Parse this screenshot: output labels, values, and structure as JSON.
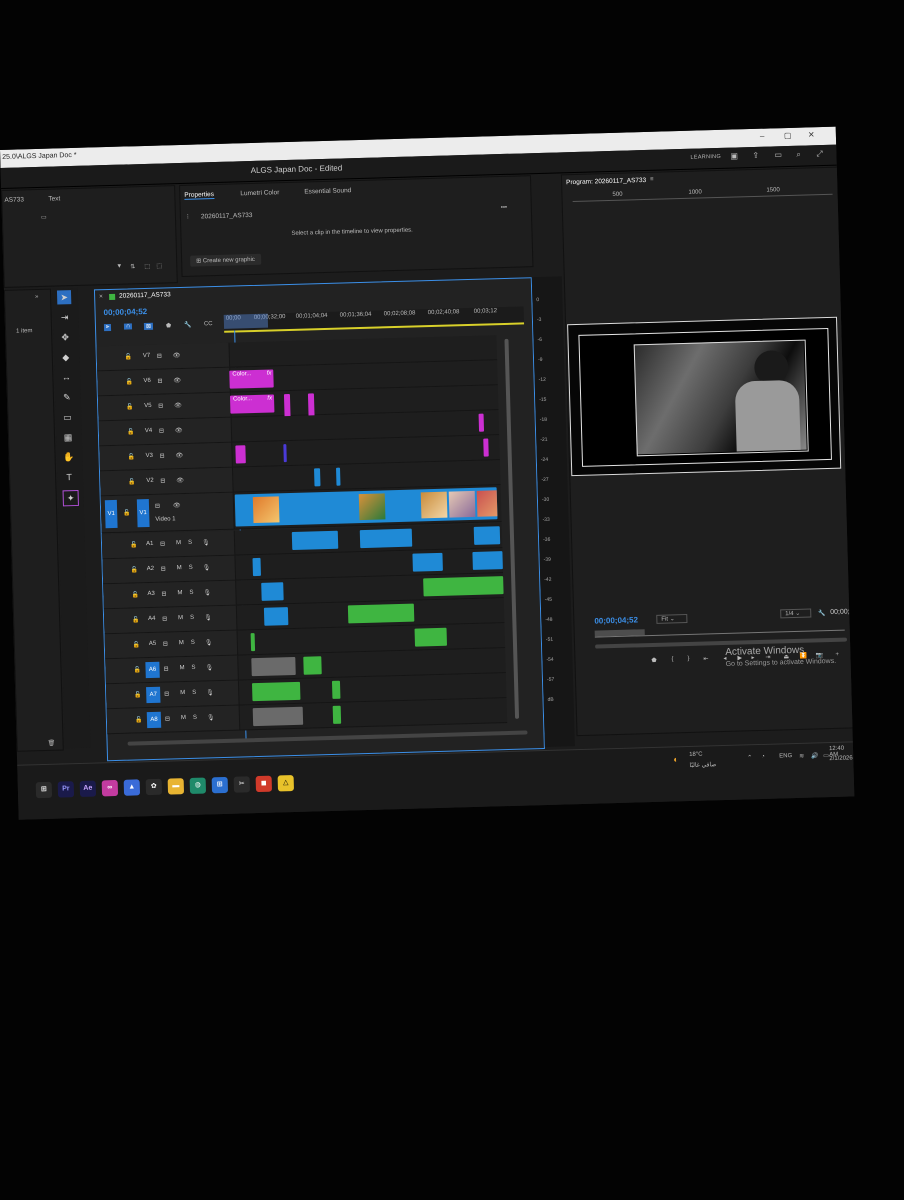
{
  "window": {
    "path_title": "25.0\\ALGS Japan Doc *",
    "app_title": "ALGS Japan Doc - Edited",
    "learning_label": "LEARNING"
  },
  "left_panel": {
    "tabs": [
      "AS733",
      "Text"
    ],
    "item_count": "1 item"
  },
  "properties_panel": {
    "tabs": [
      "Properties",
      "Lumetri Color",
      "Essential Sound"
    ],
    "sequence_name": "20260117_AS733",
    "hint": "Select a clip in the timeline to view properties.",
    "create_graphic": "Create new graphic"
  },
  "timeline": {
    "sequence_name": "20260117_AS733",
    "timecode": "00;00;04;52",
    "ruler_labels": [
      "00;00",
      "00;00;32;00",
      "00;01;04;04",
      "00;01;36;04",
      "00;02;08;08",
      "00;02;40;08",
      "00;03;12"
    ],
    "video_tracks": [
      {
        "label": "V7"
      },
      {
        "label": "V6"
      },
      {
        "label": "V5"
      },
      {
        "label": "V4"
      },
      {
        "label": "V3"
      },
      {
        "label": "V2"
      },
      {
        "label": "V1",
        "name": "Video 1",
        "source": "V1"
      }
    ],
    "audio_tracks": [
      {
        "label": "A1"
      },
      {
        "label": "A2"
      },
      {
        "label": "A3"
      },
      {
        "label": "A4"
      },
      {
        "label": "A5"
      },
      {
        "label": "A6"
      },
      {
        "label": "A7"
      },
      {
        "label": "A8"
      }
    ],
    "clip_labels": [
      "Color...",
      "Color...",
      "fx"
    ],
    "mute_label": "M",
    "solo_label": "S"
  },
  "audio_meter": {
    "db_labels": [
      "0",
      "-3",
      "-6",
      "-9",
      "-12",
      "-15",
      "-18",
      "-21",
      "-24",
      "-27",
      "-30",
      "-33",
      "-36",
      "-39",
      "-42",
      "-45",
      "-48",
      "-51",
      "-54",
      "-57",
      "dB"
    ]
  },
  "program_monitor": {
    "title": "Program: 20260117_AS733",
    "ruler_labels": [
      "500",
      "1000",
      "1500"
    ],
    "timecode": "00;00;04;52",
    "fit": "Fit",
    "resolution": "1/4",
    "duration": "00;00;33;10",
    "activate_title": "Activate Windows",
    "activate_sub": "Go to Settings to activate Windows."
  },
  "taskbar": {
    "weather_temp": "18°C",
    "weather_text": "صافي غالبًا",
    "lang": "ENG",
    "time": "12:40 AM",
    "date": "2/1/2026",
    "apps": [
      "Pr",
      "Ae"
    ]
  },
  "colors": {
    "accent": "#3b8fe8",
    "clip_magenta": "#cc2fd2",
    "clip_blue": "#1f8ad6",
    "clip_green": "#3fb541"
  }
}
